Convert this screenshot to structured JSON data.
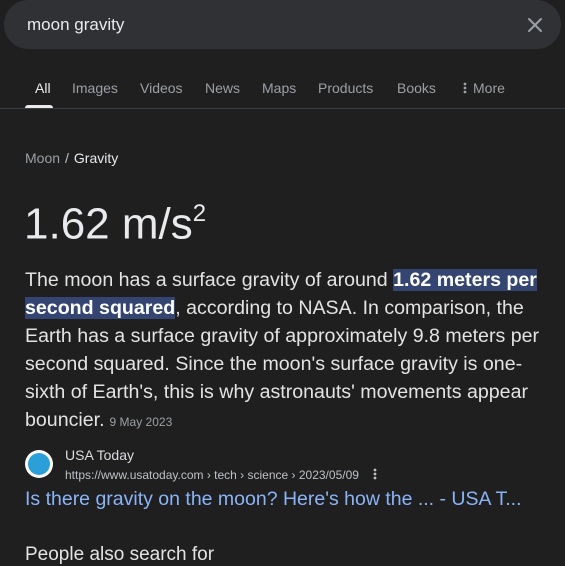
{
  "search": {
    "query": "moon gravity"
  },
  "tabs": [
    {
      "label": "All"
    },
    {
      "label": "Images"
    },
    {
      "label": "Videos"
    },
    {
      "label": "News"
    },
    {
      "label": "Maps"
    },
    {
      "label": "Products"
    },
    {
      "label": "Books"
    },
    {
      "label": "More"
    }
  ],
  "breadcrumb": {
    "parent": "Moon",
    "separator": "/",
    "current": "Gravity"
  },
  "answer": {
    "value": "1.62 m/s",
    "exponent": "2"
  },
  "snippet": {
    "before": "The moon has a surface gravity of around ",
    "highlight": "1.62 meters per second squared",
    "after": ", according to NASA. In comparison, the Earth has a surface gravity of approximately 9.8 meters per second squared. Since the moon's surface gravity is one-sixth of Earth's, this is why astronauts' movements appear bouncier.",
    "date": "9 May 2023"
  },
  "source": {
    "name": "USA Today",
    "url": "https://www.usatoday.com › tech › science › 2023/05/09"
  },
  "result": {
    "title": "Is there gravity on the moon? Here's how the ... - USA T..."
  },
  "next_section": {
    "text": "People also search for"
  },
  "colors": {
    "background": "#1f1f1f",
    "link": "#8ab4f8",
    "highlight": "#344572"
  }
}
